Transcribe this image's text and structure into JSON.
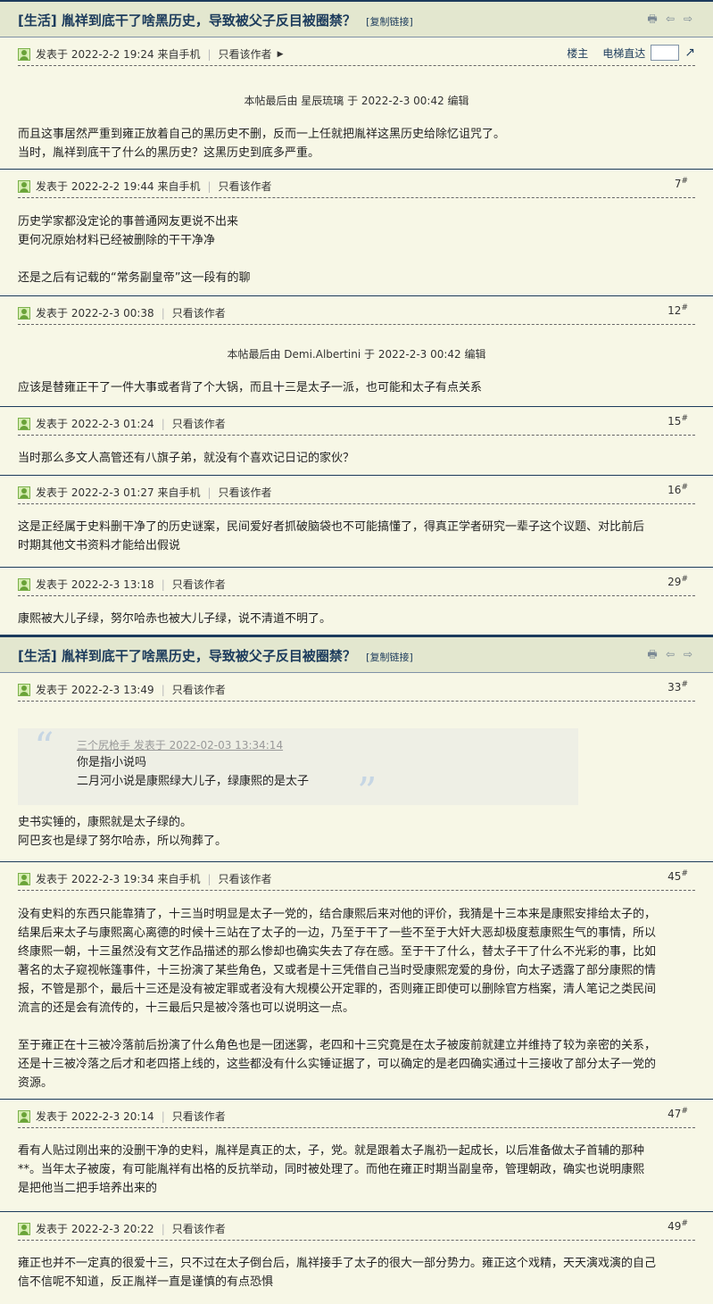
{
  "threads": [
    {
      "title": "[生活] 胤祥到底干了啥黑历史，导致被父子反目被圈禁？",
      "copy_link": "[复制链接]",
      "posts": [
        {
          "posted": "发表于 2022-2-2 19:24 来自手机",
          "only_author": "只看该作者",
          "floor_main": "楼主",
          "elevator": "电梯直达",
          "edit_note": "本帖最后由 星辰琉璃 于 2022-2-3 00:42 编辑",
          "lines": [
            "而且这事居然严重到雍正放着自己的黑历史不删，反而一上任就把胤祥这黑历史给除忆诅咒了。",
            "当时，胤祥到底干了什么的黑历史？这黑历史到底多严重。"
          ]
        },
        {
          "posted": "发表于 2022-2-2 19:44 来自手机",
          "only_author": "只看该作者",
          "floor": "7",
          "lines": [
            "历史学家都没定论的事普通网友更说不出来",
            "更何况原始材料已经被删除的干干净净",
            "",
            "还是之后有记载的“常务副皇帝”这一段有的聊"
          ]
        },
        {
          "posted": "发表于 2022-2-3 00:38",
          "only_author": "只看该作者",
          "floor": "12",
          "edit_note": "本帖最后由 Demi.Albertini 于 2022-2-3 00:42 编辑",
          "lines": [
            "应该是替雍正干了一件大事或者背了个大锅，而且十三是太子一派，也可能和太子有点关系"
          ]
        },
        {
          "posted": "发表于 2022-2-3 01:24",
          "only_author": "只看该作者",
          "floor": "15",
          "lines": [
            "当时那么多文人高管还有八旗子弟，就没有个喜欢记日记的家伙？"
          ]
        },
        {
          "posted": "发表于 2022-2-3 01:27 来自手机",
          "only_author": "只看该作者",
          "floor": "16",
          "lines": [
            "这是正经属于史料删干净了的历史谜案，民间爱好者抓破脑袋也不可能搞懂了，得真正学者研究一辈子这个议题、对比前后",
            "时期其他文书资料才能给出假说"
          ]
        },
        {
          "posted": "发表于 2022-2-3 13:18",
          "only_author": "只看该作者",
          "floor": "29",
          "lines": [
            "康熙被大儿子绿，努尔哈赤也被大儿子绿，说不清道不明了。"
          ]
        }
      ]
    },
    {
      "title": "[生活] 胤祥到底干了啥黑历史，导致被父子反目被圈禁？",
      "copy_link": "[复制链接]",
      "posts": [
        {
          "posted": "发表于 2022-2-3 13:49",
          "only_author": "只看该作者",
          "floor": "33",
          "quote": {
            "author": "三个尻枪手 发表于 2022-02-03 13:34:14",
            "lines": [
              "你是指小说吗",
              "二月河小说是康熙绿大儿子，绿康熙的是太子"
            ]
          },
          "lines": [
            "史书实锤的，康熙就是太子绿的。",
            "阿巴亥也是绿了努尔哈赤，所以殉葬了。"
          ]
        },
        {
          "posted": "发表于 2022-2-3 19:34 来自手机",
          "only_author": "只看该作者",
          "floor": "45",
          "lines": [
            "没有史料的东西只能靠猜了，十三当时明显是太子一党的，结合康熙后来对他的评价，我猜是十三本来是康熙安排给太子的，",
            "结果后来太子与康熙离心离德的时候十三站在了太子的一边，乃至于干了一些不至于大奸大恶却极度惹康熙生气的事情，所以",
            "终康熙一朝，十三虽然没有文艺作品描述的那么惨却也确实失去了存在感。至于干了什么，替太子干了什么不光彩的事，比如",
            "著名的太子窥视帐篷事件，十三扮演了某些角色，又或者是十三凭借自己当时受康熙宠爱的身份，向太子透露了部分康熙的情",
            "报，不管是那个，最后十三还是没有被定罪或者没有大规模公开定罪的，否则雍正即使可以删除官方档案，清人笔记之类民间",
            "流言的还是会有流传的，十三最后只是被冷落也可以说明这一点。",
            "",
            "至于雍正在十三被冷落前后扮演了什么角色也是一团迷雾，老四和十三究竟是在太子被废前就建立并维持了较为亲密的关系，",
            "还是十三被冷落之后才和老四搭上线的，这些都没有什么实锤证据了，可以确定的是老四确实通过十三接收了部分太子一党的",
            "资源。"
          ]
        },
        {
          "posted": "发表于 2022-2-3 20:14",
          "only_author": "只看该作者",
          "floor": "47",
          "lines": [
            "看有人贴过刚出来的没删干净的史料，胤祥是真正的太，子，党。就是跟着太子胤礽一起成长，以后准备做太子首辅的那种",
            "**。当年太子被废，有可能胤祥有出格的反抗举动，同时被处理了。而他在雍正时期当副皇帝，管理朝政，确实也说明康熙",
            "是把他当二把手培养出来的"
          ]
        },
        {
          "posted": "发表于 2022-2-3 20:22",
          "only_author": "只看该作者",
          "floor": "49",
          "lines": [
            "雍正也并不一定真的很爱十三，只不过在太子倒台后，胤祥接手了太子的很大一部分势力。雍正这个戏精，天天演戏演的自己",
            "信不信呢不知道，反正胤祥一直是谨慎的有点恐惧"
          ]
        }
      ]
    }
  ]
}
